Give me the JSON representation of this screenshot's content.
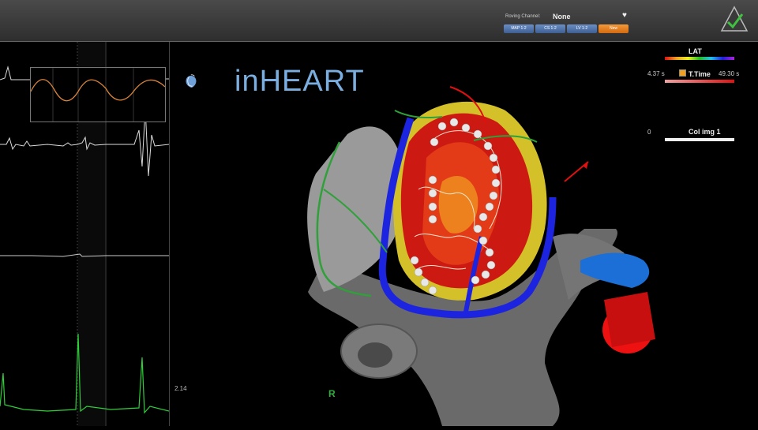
{
  "roving": {
    "label": "Roving Channel:",
    "value": "None",
    "buttons": [
      "MAP 1-2",
      "CS 1-2",
      "LV 1-2",
      "New"
    ]
  },
  "brand": {
    "name": "inHEART"
  },
  "legend": {
    "lat_title": "LAT",
    "ttime_title": "T.Time",
    "ttime_min": "4.37 s",
    "ttime_max": "49.30 s",
    "colimg_title": "Col img 1",
    "colimg_min": "0"
  },
  "viewport": {
    "time_readout": "2.14",
    "orientation_marker": "R"
  },
  "colors": {
    "accent_blue": "#5a7fc0",
    "active_orange": "#e07a20",
    "ecg_green": "#2fcf3a",
    "brand_blue": "#7aaee0"
  }
}
